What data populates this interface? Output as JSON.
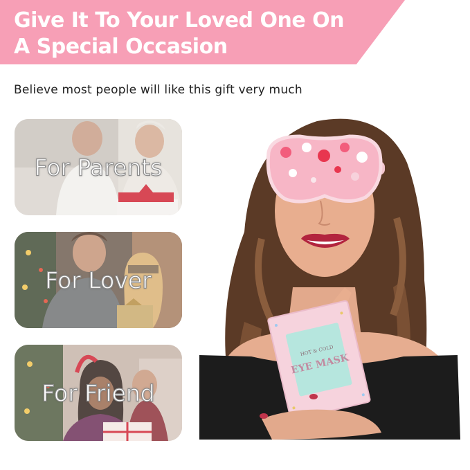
{
  "banner": {
    "line1": "Give It To Your Loved One On",
    "line2": "A Special Occasion",
    "color": "#f79fb6"
  },
  "subtitle": "Believe most people will like this gift very much",
  "cards": [
    {
      "label": "For Parents"
    },
    {
      "label": "For Lover"
    },
    {
      "label": "For Friend"
    }
  ],
  "product": {
    "box_small_text": "HOT & COLD",
    "box_main_text": "EYE MASK"
  }
}
